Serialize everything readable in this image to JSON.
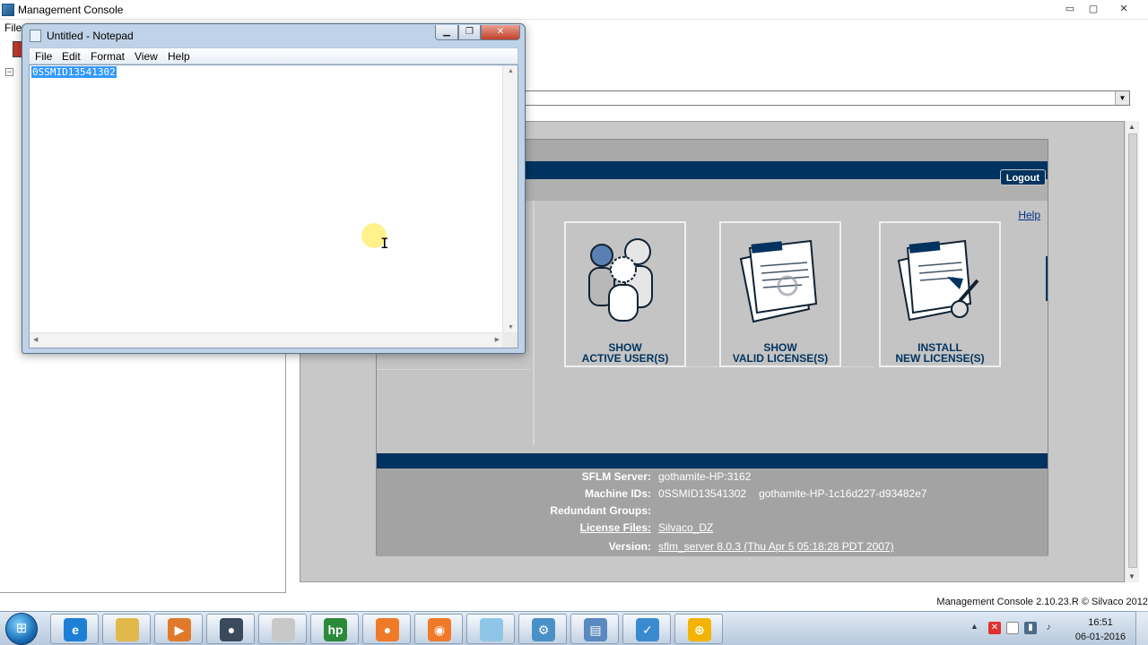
{
  "management_console": {
    "title": "Management Console",
    "menu_file": "File",
    "window_controls": {
      "minimize": "▭",
      "maximize": "▢",
      "close": "✕"
    },
    "status_text": "Management Console 2.10.23.R © Silvaco 2012"
  },
  "sflm_page": {
    "logout_label": "Logout",
    "help_label": "Help",
    "tiles": [
      {
        "line1": "SHOW",
        "line2": "ACTIVE USER(S)"
      },
      {
        "line1": "SHOW",
        "line2": "VALID LICENSE(S)"
      },
      {
        "line1": "INSTALL",
        "line2": "NEW LICENSE(S)"
      }
    ],
    "info": {
      "server_label": "SFLM Server:",
      "server_value": "gothamite-HP:3162",
      "machine_label": "Machine IDs:",
      "machine_id_1": "0SSMID13541302",
      "machine_id_2": "gothamite-HP-1c16d227-d93482e7",
      "redundant_label": "Redundant Groups:",
      "redundant_value": "",
      "license_files_label": "License Files:",
      "license_files_value": "Silvaco_DZ",
      "version_label": "Version:",
      "version_value": "sflm_server 8.0.3 (Thu Apr 5 05:18:28 PDT 2007)"
    }
  },
  "notepad": {
    "title": "Untitled - Notepad",
    "menus": [
      "File",
      "Edit",
      "Format",
      "View",
      "Help"
    ],
    "content": "0SSMID13541302",
    "content_selected": true
  },
  "taskbar": {
    "apps": [
      {
        "name": "internet-explorer-icon",
        "color": "#1e7fd6",
        "glyph": "e"
      },
      {
        "name": "file-explorer-icon",
        "color": "#e0b94a",
        "glyph": ""
      },
      {
        "name": "media-player-icon",
        "color": "#e07a2a",
        "glyph": "▶"
      },
      {
        "name": "webcam-icon",
        "color": "#3a4a5c",
        "glyph": "●"
      },
      {
        "name": "printer-icon",
        "color": "#c8c8c8",
        "glyph": ""
      },
      {
        "name": "hp-icon",
        "color": "#2a8a3a",
        "glyph": "hp"
      },
      {
        "name": "camera-app-icon",
        "color": "#f07a28",
        "glyph": "●"
      },
      {
        "name": "screenshot-app-icon",
        "color": "#f07a28",
        "glyph": "◉"
      },
      {
        "name": "notepad-icon",
        "color": "#8fc6e8",
        "glyph": ""
      },
      {
        "name": "network-tool-icon",
        "color": "#4a90c8",
        "glyph": "⚙"
      },
      {
        "name": "management-console-icon",
        "color": "#5a88c0",
        "glyph": "▤"
      },
      {
        "name": "globe-check-icon",
        "color": "#3a8ad0",
        "glyph": "✓"
      },
      {
        "name": "sflm-globe-icon",
        "color": "#f2b400",
        "glyph": "⊕"
      }
    ],
    "clock_time": "16:51",
    "clock_date": "06-01-2016"
  }
}
